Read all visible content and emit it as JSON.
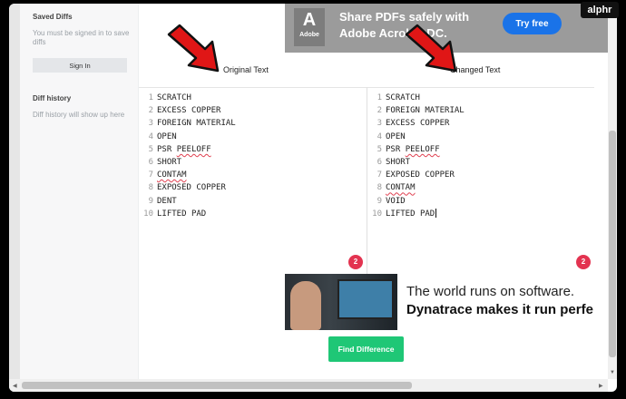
{
  "sidebar": {
    "saved_title": "Saved Diffs",
    "saved_note": "You must be signed in to save diffs",
    "signin_label": "Sign In",
    "history_title": "Diff history",
    "history_note": "Diff history will show up here"
  },
  "ad_top": {
    "logo_text": "Adobe",
    "line1": "Share PDFs safely with",
    "line2": "Adobe Acrobat DC.",
    "button": "Try free"
  },
  "columns": {
    "left_label": "Original Text",
    "right_label": "Changed Text"
  },
  "original_lines": [
    {
      "n": "1",
      "text": "SCRATCH"
    },
    {
      "n": "2",
      "text": "EXCESS COPPER"
    },
    {
      "n": "3",
      "text": "FOREIGN MATERIAL"
    },
    {
      "n": "4",
      "text": "OPEN"
    },
    {
      "n": "5",
      "text": "PSR PEELOFF"
    },
    {
      "n": "6",
      "text": "SHORT"
    },
    {
      "n": "7",
      "text": "CONTAM"
    },
    {
      "n": "8",
      "text": "EXPOSED COPPER"
    },
    {
      "n": "9",
      "text": "DENT"
    },
    {
      "n": "10",
      "text": "LIFTED PAD"
    }
  ],
  "changed_lines": [
    {
      "n": "1",
      "text": "SCRATCH"
    },
    {
      "n": "2",
      "text": "FOREIGN MATERIAL"
    },
    {
      "n": "3",
      "text": "EXCESS COPPER"
    },
    {
      "n": "4",
      "text": "OPEN"
    },
    {
      "n": "5",
      "text": "PSR PEELOFF"
    },
    {
      "n": "6",
      "text": "SHORT"
    },
    {
      "n": "7",
      "text": "EXPOSED COPPER"
    },
    {
      "n": "8",
      "text": "CONTAM"
    },
    {
      "n": "9",
      "text": "VOID"
    },
    {
      "n": "10",
      "text": "LIFTED PAD"
    }
  ],
  "badges": {
    "left": "2",
    "right": "2"
  },
  "ad_bottom": {
    "line1": "The world runs on software.",
    "line2": "Dynatrace makes it run perfe"
  },
  "find_button": "Find Difference",
  "watermark": "alphr",
  "colors": {
    "accent_green": "#1fc776",
    "badge_red": "#e33350",
    "arrow_red": "#e01616",
    "try_blue": "#1a73e8"
  }
}
